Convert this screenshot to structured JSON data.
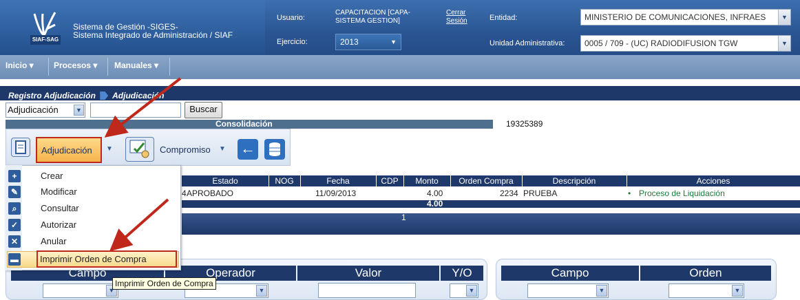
{
  "header": {
    "logo_tag": "SIAF-SAG",
    "system_line1": "Sistema de Gestión -SIGES-",
    "system_line2": "Sistema Integrado de Administración / SIAF",
    "usuario_label": "Usuario:",
    "usuario_value_1": "CAPACITACION [CAPA-",
    "usuario_value_2": "SISTEMA GESTION]",
    "cerrar_1": "Cerrar",
    "cerrar_2": "Sesión",
    "ejercicio_label": "Ejercicio:",
    "ejercicio_value": "2013",
    "entidad_label": "Entidad:",
    "entidad_value": "MINISTERIO DE COMUNICACIONES, INFRAES",
    "unidad_label": "Unidad Administrativa:",
    "unidad_value": "0005 / 709 - (UC) RADIODIFUSION TGW"
  },
  "menu": {
    "inicio": "Inicio",
    "procesos": "Procesos",
    "manuales": "Manuales"
  },
  "breadcrumb": {
    "part1": "Registro Adjudicación",
    "part2": "Adjudicación"
  },
  "search": {
    "type_value": "Adjudicación",
    "button": "Buscar"
  },
  "consolidacion": {
    "label": "Consolidación",
    "value": "19325389"
  },
  "toolbar": {
    "adjudicacion": "Adjudicación",
    "compromiso": "Compromiso"
  },
  "dropdown": {
    "items": [
      {
        "label": "Crear",
        "icon": "new-doc-icon"
      },
      {
        "label": "Modificar",
        "icon": "edit-icon"
      },
      {
        "label": "Consultar",
        "icon": "search-doc-icon"
      },
      {
        "label": "Autorizar",
        "icon": "check-icon"
      },
      {
        "label": "Anular",
        "icon": "x-icon"
      },
      {
        "label": "Imprimir Orden de Compra",
        "icon": "printer-icon"
      }
    ]
  },
  "table": {
    "headers": [
      "Estado",
      "NOG",
      "Fecha",
      "CDP",
      "Monto",
      "Orden Compra",
      "Descripción",
      "Acciones"
    ],
    "row": {
      "prefix": "4",
      "estado": "APROBADO",
      "fecha": "11/09/2013",
      "monto": "4.00",
      "orden_compra": "2234",
      "descripcion": "PRUEBA",
      "accion": "Proceso de Liquidación"
    },
    "total": "4.00",
    "page": "1"
  },
  "filters": {
    "left_headers": [
      "Campo",
      "Operador",
      "Valor",
      "Y/O"
    ],
    "right_headers": [
      "Campo",
      "Orden"
    ]
  },
  "tooltip": "Imprimir Orden de Compra",
  "colors": {
    "navy": "#1e3869",
    "highlight": "#c0281c",
    "accent_orange": "#f6b34c"
  }
}
